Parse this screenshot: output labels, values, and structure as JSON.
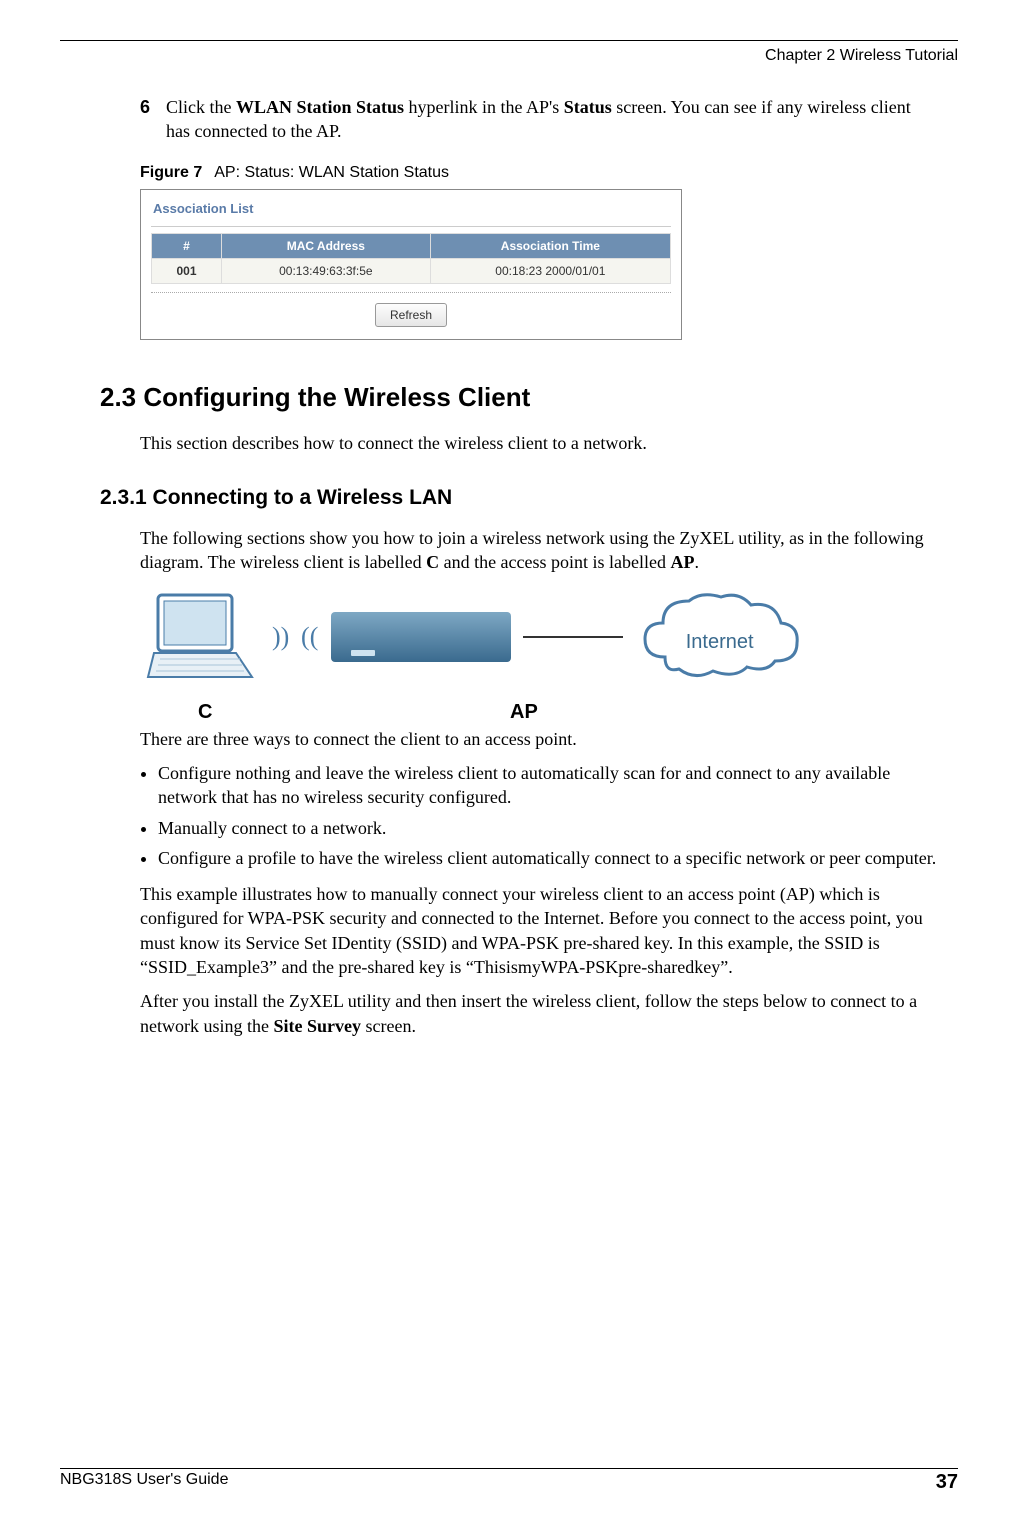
{
  "chapter_header": "Chapter 2 Wireless Tutorial",
  "step": {
    "num": "6",
    "pre": "Click the ",
    "link": "WLAN Station Status",
    "mid": " hyperlink in the AP's ",
    "bold2": "Status",
    "post": " screen. You can see if any wireless client has connected to the AP."
  },
  "figure": {
    "num": "Figure 7",
    "title": "AP: Status: WLAN Station Status"
  },
  "assoc": {
    "panel_title": "Association List",
    "headers": [
      "#",
      "MAC Address",
      "Association Time"
    ],
    "row": [
      "001",
      "00:13:49:63:3f:5e",
      "00:18:23 2000/01/01"
    ],
    "refresh": "Refresh"
  },
  "sec23": {
    "heading": "2.3  Configuring the Wireless Client",
    "intro": "This section describes how to connect the wireless client to a network."
  },
  "sec231": {
    "heading": "2.3.1  Connecting to a Wireless LAN",
    "p1_pre": "The following sections show you how to join a wireless network using the ZyXEL utility, as in the following diagram. The wireless client is labelled ",
    "p1_c": "C",
    "p1_mid": " and the access point is labelled ",
    "p1_ap": "AP",
    "p1_post": ".",
    "diagram_labels": {
      "c": "C",
      "ap": "AP",
      "internet": "Internet"
    },
    "p2": "There are three ways to connect the client to an access point.",
    "bullets": [
      "Configure nothing and leave the wireless client to automatically scan for and connect to any available network that has no wireless security configured.",
      "Manually connect to a network.",
      "Configure a profile to have the wireless client automatically connect to a specific network or peer computer."
    ],
    "p3": "This example illustrates how to manually connect your wireless client to an access point (AP) which is configured for WPA-PSK security and connected to the Internet. Before you connect to the access point, you must know its Service Set IDentity (SSID) and WPA-PSK pre-shared key. In this example, the SSID is “SSID_Example3” and the pre-shared key is “ThisismyWPA-PSKpre-sharedkey”.",
    "p4_pre": "After you install the ZyXEL utility and then insert the wireless client, follow the steps below to connect to a network using the ",
    "p4_bold": "Site Survey",
    "p4_post": " screen."
  },
  "footer": {
    "guide": "NBG318S User's Guide",
    "page": "37"
  }
}
